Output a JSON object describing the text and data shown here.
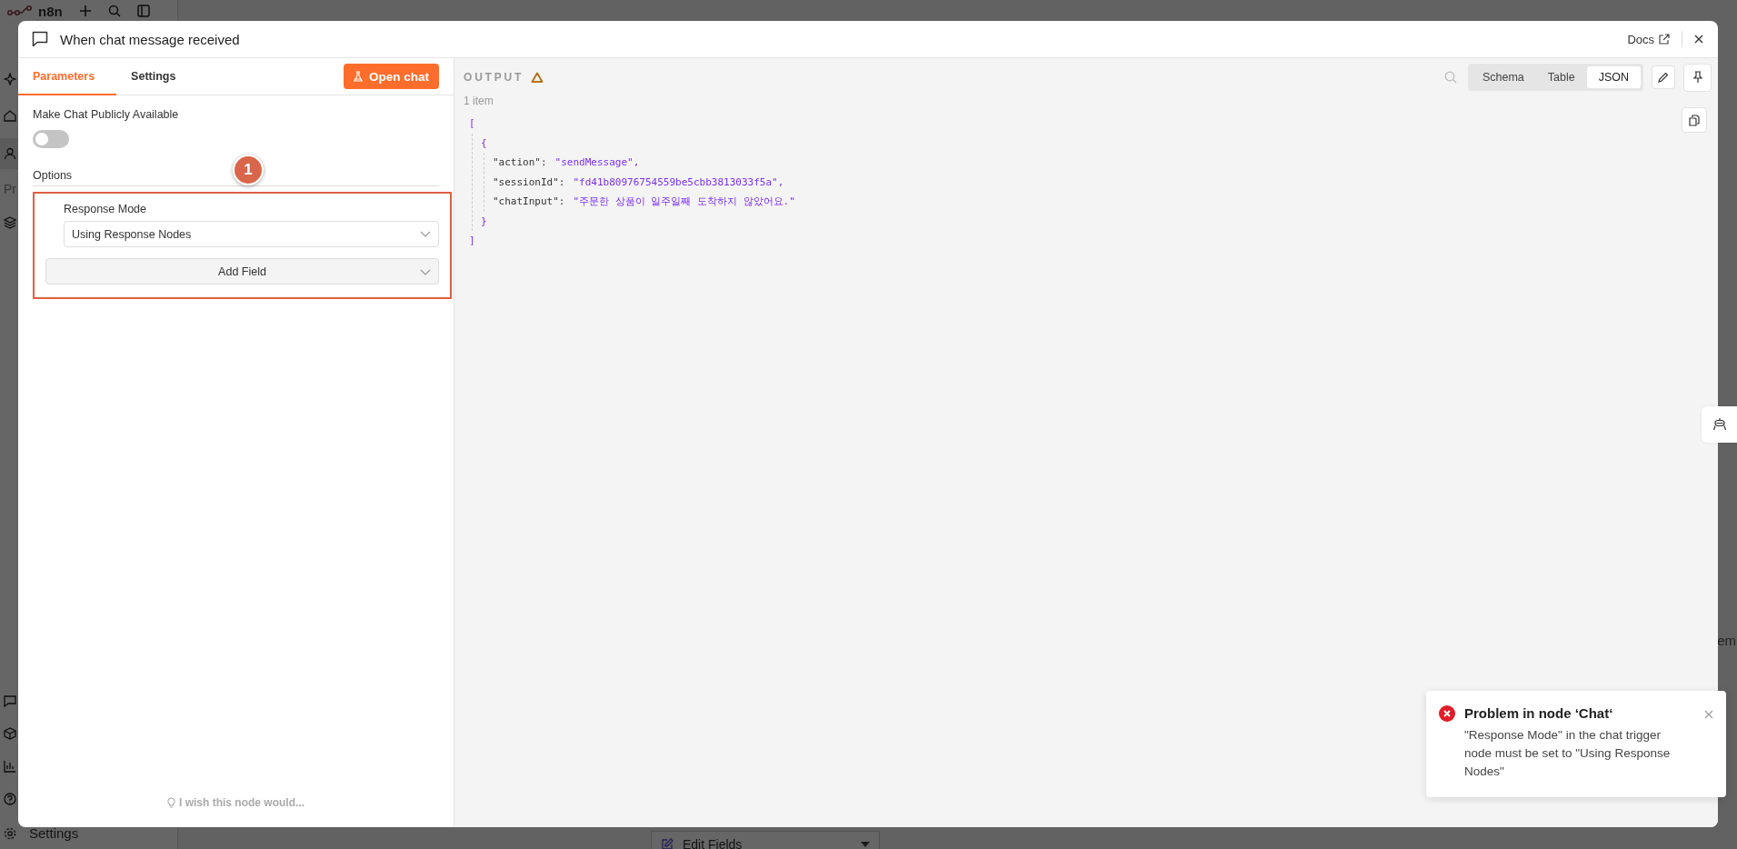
{
  "background": {
    "logo": "n8n",
    "sidebar_section": "Pr",
    "sidebar_footer": "Settings",
    "canvas_node": "Edit Fields",
    "canvas_fragment": "em"
  },
  "modal": {
    "title": "When chat message received",
    "docs": "Docs"
  },
  "tabs": [
    {
      "label": "Parameters",
      "selected": true
    },
    {
      "label": "Settings",
      "selected": false
    }
  ],
  "open_chat": "Open chat",
  "parameters": {
    "public_label": "Make Chat Publicly Available",
    "public_on": false,
    "options_label": "Options",
    "callout": "1",
    "response_mode_label": "Response Mode",
    "response_mode_value": "Using Response Nodes",
    "add_field": "Add Field"
  },
  "feedback": "I wish this node would...",
  "output": {
    "title": "OUTPUT",
    "count": "1 item",
    "views": [
      {
        "label": "Schema",
        "selected": false
      },
      {
        "label": "Table",
        "selected": false
      },
      {
        "label": "JSON",
        "selected": true
      }
    ],
    "json": {
      "array_open": "[",
      "object_open": "{",
      "fields": [
        {
          "key": "\"action\":",
          "value": "\"sendMessage\","
        },
        {
          "key": "\"sessionId\":",
          "value": "\"fd41b80976754559be5cbb3813033f5a\","
        },
        {
          "key": "\"chatInput\":",
          "value": "\"주문한 상품이 일주일째 도착하지 않았어요.\""
        }
      ],
      "object_close": "}",
      "array_close": "]"
    }
  },
  "toast": {
    "title": "Problem in node ‘Chat‘",
    "message": "\"Response Mode\" in the chat trigger node must be set to \"Using Response Nodes\""
  }
}
